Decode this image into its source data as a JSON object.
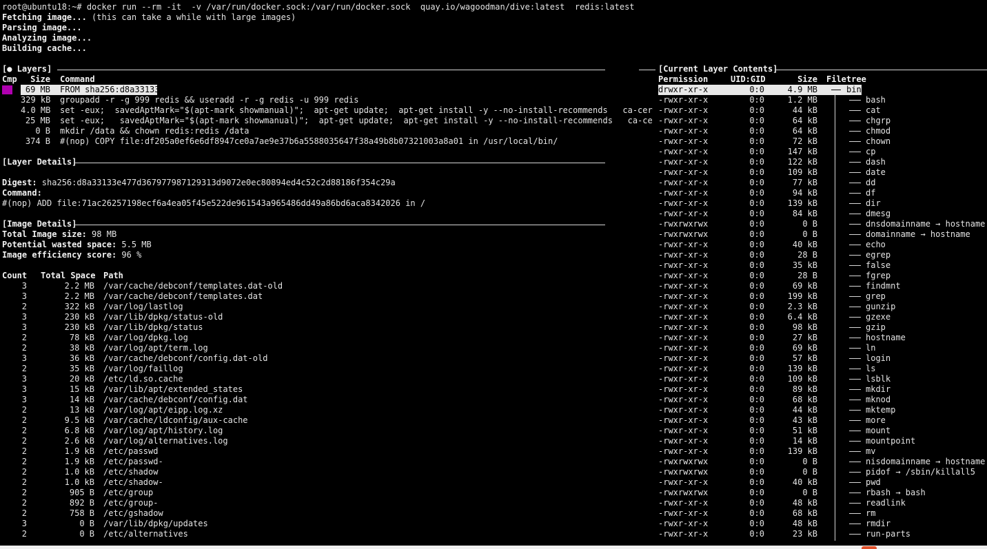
{
  "shell": {
    "prompt": "root@ubuntu18:~#",
    "command": "docker run --rm -it  -v /var/run/docker.sock:/var/run/docker.sock  quay.io/wagoodman/dive:latest  redis:latest",
    "output": [
      {
        "bold": "Fetching image...",
        "rest": " (this can take a while with large images)"
      },
      {
        "bold": "Parsing image...",
        "rest": ""
      },
      {
        "bold": "Analyzing image...",
        "rest": ""
      },
      {
        "bold": "Building cache...",
        "rest": ""
      }
    ]
  },
  "layers": {
    "title": "[● Layers]",
    "headers": {
      "cmp": "Cmp",
      "size": "Size",
      "command": "Command"
    },
    "rows": [
      {
        "size": "69 MB",
        "command": "FROM sha256:d8a33133",
        "selected": true
      },
      {
        "size": "329 kB",
        "command": "groupadd -r -g 999 redis && useradd -r -g redis -u 999 redis"
      },
      {
        "size": "4.0 MB",
        "command": "set -eux;  savedAptMark=\"$(apt-mark showmanual)\";  apt-get update;  apt-get install -y --no-install-recommends   ca-certifi"
      },
      {
        "size": "25 MB",
        "command": "set -eux;   savedAptMark=\"$(apt-mark showmanual)\";  apt-get update;  apt-get install -y --no-install-recommends   ca-certif"
      },
      {
        "size": "0 B",
        "command": "mkdir /data && chown redis:redis /data"
      },
      {
        "size": "374 B",
        "command": "#(nop) COPY file:df205a0ef6e6df8947ce0a7ae9e37b6a5588035647f38a49b8b07321003a8a01 in /usr/local/bin/"
      }
    ],
    "cmp_color": "#b000b0"
  },
  "layer_details": {
    "title": "[Layer Details]",
    "digest_label": "Digest:",
    "digest_value": " sha256:d8a33133e477d367977987129313d9072e0ec80894ed4c52c2d88186f354c29a",
    "command_label": "Command:",
    "command_value": "#(nop) ADD file:71ac26257198ecf6a4ea05f45e522de961543a965486dd49a86bd6aca8342026 in /"
  },
  "image_details": {
    "title": "[Image Details]",
    "total_size_label": "Total Image size:",
    "total_size_value": " 98 MB",
    "wasted_label": "Potential wasted space:",
    "wasted_value": " 5.5 MB",
    "efficiency_label": "Image efficiency score:",
    "efficiency_value": " 96 %",
    "headers": {
      "count": "Count",
      "total": "Total Space",
      "path": "Path"
    },
    "rows": [
      {
        "count": "3",
        "space": "2.2 MB",
        "path": "/var/cache/debconf/templates.dat-old"
      },
      {
        "count": "3",
        "space": "2.2 MB",
        "path": "/var/cache/debconf/templates.dat"
      },
      {
        "count": "2",
        "space": "322 kB",
        "path": "/var/log/lastlog"
      },
      {
        "count": "3",
        "space": "230 kB",
        "path": "/var/lib/dpkg/status-old"
      },
      {
        "count": "3",
        "space": "230 kB",
        "path": "/var/lib/dpkg/status"
      },
      {
        "count": "2",
        "space": "78 kB",
        "path": "/var/log/dpkg.log"
      },
      {
        "count": "2",
        "space": "38 kB",
        "path": "/var/log/apt/term.log"
      },
      {
        "count": "3",
        "space": "36 kB",
        "path": "/var/cache/debconf/config.dat-old"
      },
      {
        "count": "2",
        "space": "35 kB",
        "path": "/var/log/faillog"
      },
      {
        "count": "3",
        "space": "20 kB",
        "path": "/etc/ld.so.cache"
      },
      {
        "count": "3",
        "space": "15 kB",
        "path": "/var/lib/apt/extended_states"
      },
      {
        "count": "3",
        "space": "14 kB",
        "path": "/var/cache/debconf/config.dat"
      },
      {
        "count": "2",
        "space": "13 kB",
        "path": "/var/log/apt/eipp.log.xz"
      },
      {
        "count": "2",
        "space": "9.5 kB",
        "path": "/var/cache/ldconfig/aux-cache"
      },
      {
        "count": "2",
        "space": "6.8 kB",
        "path": "/var/log/apt/history.log"
      },
      {
        "count": "2",
        "space": "2.6 kB",
        "path": "/var/log/alternatives.log"
      },
      {
        "count": "2",
        "space": "1.9 kB",
        "path": "/etc/passwd"
      },
      {
        "count": "2",
        "space": "1.9 kB",
        "path": "/etc/passwd-"
      },
      {
        "count": "2",
        "space": "1.0 kB",
        "path": "/etc/shadow"
      },
      {
        "count": "2",
        "space": "1.0 kB",
        "path": "/etc/shadow-"
      },
      {
        "count": "2",
        "space": "905 B",
        "path": "/etc/group"
      },
      {
        "count": "2",
        "space": "892 B",
        "path": "/etc/group-"
      },
      {
        "count": "2",
        "space": "758 B",
        "path": "/etc/gshadow"
      },
      {
        "count": "3",
        "space": "0 B",
        "path": "/var/lib/dpkg/updates"
      },
      {
        "count": "2",
        "space": "0 B",
        "path": "/etc/alternatives"
      }
    ]
  },
  "contents": {
    "title": "[Current Layer Contents]",
    "headers": {
      "perm": "Permission",
      "uid": "UID:GID",
      "size": "Size",
      "tree": "Filetree"
    },
    "root": {
      "perm": "drwxr-xr-x",
      "uid": "0:0",
      "size": "4.9 MB",
      "name": "bin"
    },
    "files": [
      {
        "perm": "-rwxr-xr-x",
        "uid": "0:0",
        "size": "1.2 MB",
        "name": "bash"
      },
      {
        "perm": "-rwxr-xr-x",
        "uid": "0:0",
        "size": "44 kB",
        "name": "cat"
      },
      {
        "perm": "-rwxr-xr-x",
        "uid": "0:0",
        "size": "64 kB",
        "name": "chgrp"
      },
      {
        "perm": "-rwxr-xr-x",
        "uid": "0:0",
        "size": "64 kB",
        "name": "chmod"
      },
      {
        "perm": "-rwxr-xr-x",
        "uid": "0:0",
        "size": "72 kB",
        "name": "chown"
      },
      {
        "perm": "-rwxr-xr-x",
        "uid": "0:0",
        "size": "147 kB",
        "name": "cp"
      },
      {
        "perm": "-rwxr-xr-x",
        "uid": "0:0",
        "size": "122 kB",
        "name": "dash"
      },
      {
        "perm": "-rwxr-xr-x",
        "uid": "0:0",
        "size": "109 kB",
        "name": "date"
      },
      {
        "perm": "-rwxr-xr-x",
        "uid": "0:0",
        "size": "77 kB",
        "name": "dd"
      },
      {
        "perm": "-rwxr-xr-x",
        "uid": "0:0",
        "size": "94 kB",
        "name": "df"
      },
      {
        "perm": "-rwxr-xr-x",
        "uid": "0:0",
        "size": "139 kB",
        "name": "dir"
      },
      {
        "perm": "-rwxr-xr-x",
        "uid": "0:0",
        "size": "84 kB",
        "name": "dmesg"
      },
      {
        "perm": "-rwxrwxrwx",
        "uid": "0:0",
        "size": "0 B",
        "name": "dnsdomainname → hostname"
      },
      {
        "perm": "-rwxrwxrwx",
        "uid": "0:0",
        "size": "0 B",
        "name": "domainname → hostname"
      },
      {
        "perm": "-rwxr-xr-x",
        "uid": "0:0",
        "size": "40 kB",
        "name": "echo"
      },
      {
        "perm": "-rwxr-xr-x",
        "uid": "0:0",
        "size": "28 B",
        "name": "egrep"
      },
      {
        "perm": "-rwxr-xr-x",
        "uid": "0:0",
        "size": "35 kB",
        "name": "false"
      },
      {
        "perm": "-rwxr-xr-x",
        "uid": "0:0",
        "size": "28 B",
        "name": "fgrep"
      },
      {
        "perm": "-rwxr-xr-x",
        "uid": "0:0",
        "size": "69 kB",
        "name": "findmnt"
      },
      {
        "perm": "-rwxr-xr-x",
        "uid": "0:0",
        "size": "199 kB",
        "name": "grep"
      },
      {
        "perm": "-rwxr-xr-x",
        "uid": "0:0",
        "size": "2.3 kB",
        "name": "gunzip"
      },
      {
        "perm": "-rwxr-xr-x",
        "uid": "0:0",
        "size": "6.4 kB",
        "name": "gzexe"
      },
      {
        "perm": "-rwxr-xr-x",
        "uid": "0:0",
        "size": "98 kB",
        "name": "gzip"
      },
      {
        "perm": "-rwxr-xr-x",
        "uid": "0:0",
        "size": "27 kB",
        "name": "hostname"
      },
      {
        "perm": "-rwxr-xr-x",
        "uid": "0:0",
        "size": "69 kB",
        "name": "ln"
      },
      {
        "perm": "-rwxr-xr-x",
        "uid": "0:0",
        "size": "57 kB",
        "name": "login"
      },
      {
        "perm": "-rwxr-xr-x",
        "uid": "0:0",
        "size": "139 kB",
        "name": "ls"
      },
      {
        "perm": "-rwxr-xr-x",
        "uid": "0:0",
        "size": "109 kB",
        "name": "lsblk"
      },
      {
        "perm": "-rwxr-xr-x",
        "uid": "0:0",
        "size": "89 kB",
        "name": "mkdir"
      },
      {
        "perm": "-rwxr-xr-x",
        "uid": "0:0",
        "size": "68 kB",
        "name": "mknod"
      },
      {
        "perm": "-rwxr-xr-x",
        "uid": "0:0",
        "size": "44 kB",
        "name": "mktemp"
      },
      {
        "perm": "-rwxr-xr-x",
        "uid": "0:0",
        "size": "43 kB",
        "name": "more"
      },
      {
        "perm": "-rwxr-xr-x",
        "uid": "0:0",
        "size": "51 kB",
        "name": "mount"
      },
      {
        "perm": "-rwxr-xr-x",
        "uid": "0:0",
        "size": "14 kB",
        "name": "mountpoint"
      },
      {
        "perm": "-rwxr-xr-x",
        "uid": "0:0",
        "size": "139 kB",
        "name": "mv"
      },
      {
        "perm": "-rwxrwxrwx",
        "uid": "0:0",
        "size": "0 B",
        "name": "nisdomainname → hostname"
      },
      {
        "perm": "-rwxrwxrwx",
        "uid": "0:0",
        "size": "0 B",
        "name": "pidof → /sbin/killall5"
      },
      {
        "perm": "-rwxr-xr-x",
        "uid": "0:0",
        "size": "40 kB",
        "name": "pwd"
      },
      {
        "perm": "-rwxrwxrwx",
        "uid": "0:0",
        "size": "0 B",
        "name": "rbash → bash"
      },
      {
        "perm": "-rwxr-xr-x",
        "uid": "0:0",
        "size": "48 kB",
        "name": "readlink"
      },
      {
        "perm": "-rwxr-xr-x",
        "uid": "0:0",
        "size": "68 kB",
        "name": "rm"
      },
      {
        "perm": "-rwxr-xr-x",
        "uid": "0:0",
        "size": "48 kB",
        "name": "rmdir"
      },
      {
        "perm": "-rwxr-xr-x",
        "uid": "0:0",
        "size": "23 kB",
        "name": "run-parts"
      }
    ]
  }
}
